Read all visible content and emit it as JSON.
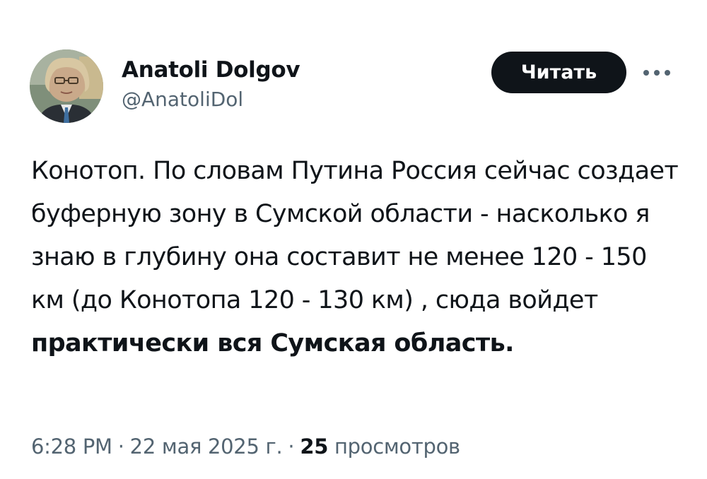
{
  "author": {
    "display_name": "Anatoli Dolgov",
    "handle": "@AnatoliDol"
  },
  "actions": {
    "follow_label": "Читать",
    "more_icon": "more-horizontal-icon"
  },
  "tweet": {
    "text_plain": "Конотоп. По словам Путина Россия сейчас создает буферную зону в Сумской области - насколько я знаю в глубину она составит не менее 120 - 150 км (до Конотопа 120 - 130 км) , сюда войдет ",
    "text_bold": "практически вся Сумская область."
  },
  "meta": {
    "time": "6:28 PM",
    "separator": "·",
    "date": "22 мая 2025 г.",
    "views_count": "25",
    "views_label": "просмотров"
  },
  "colors": {
    "text_primary": "#0f1419",
    "text_secondary": "#536471",
    "follow_button_bg": "#0f1419",
    "follow_button_text": "#ffffff"
  }
}
